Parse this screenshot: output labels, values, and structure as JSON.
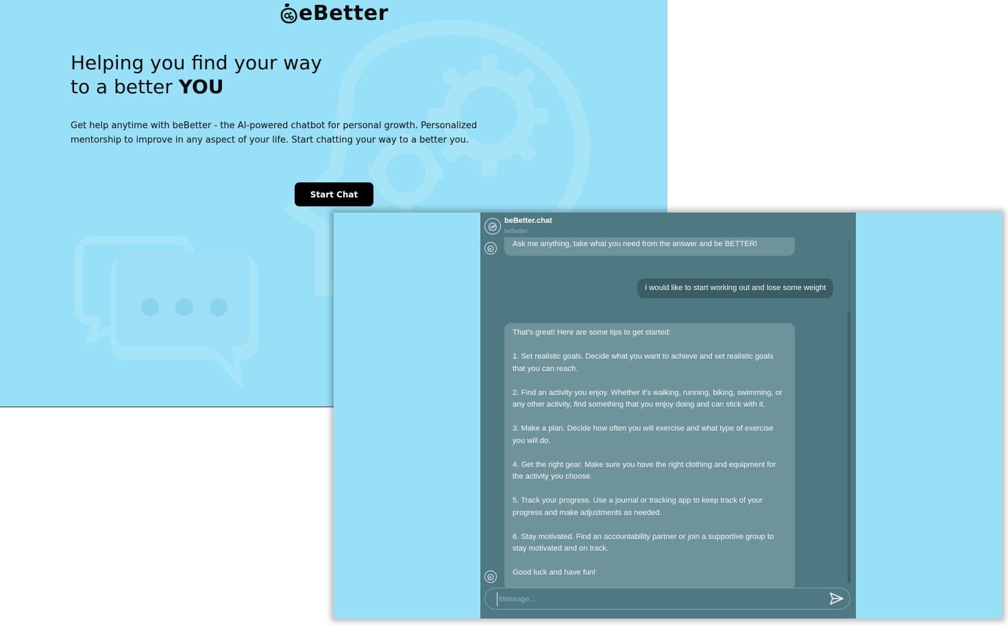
{
  "landing": {
    "brand": "eBetter",
    "hero_line1": "Helping you find your way",
    "hero_line2_prefix": "to a better ",
    "hero_line2_emphasis": "YOU",
    "description": "Get help anytime with beBetter - the AI-powered chatbot for personal growth. Personalized mentorship to improve in any aspect of your life. Start chatting your way to a better you.",
    "cta_label": "Start Chat"
  },
  "chat": {
    "title": "beBetter.chat",
    "subtitle": "beBetter",
    "messages": [
      {
        "sender": "bot",
        "text": "Ask me anything, take what you need from the answer and be BETTER!"
      },
      {
        "sender": "user",
        "text": "I would like to start working out and lose some weight"
      },
      {
        "sender": "bot",
        "paragraphs": [
          "That's great! Here are some tips to get started:",
          "1. Set realistic goals. Decide what you want to achieve and set realistic goals that you can reach.",
          "2. Find an activity you enjoy. Whether it's walking, running, biking, swimming, or any other activity, find something that you enjoy doing and can stick with it.",
          "3. Make a plan. Decide how often you will exercise and what type of exercise you will do.",
          "4. Get the right gear. Make sure you have the right clothing and equipment for the activity you choose.",
          "5. Track your progress. Use a journal or tracking app to keep track of your progress and make adjustments as needed.",
          "6. Stay motivated. Find an accountability partner or join a supportive group to stay motivated and on track.",
          "Good luck and have fun!"
        ]
      }
    ],
    "input_placeholder": "Message...",
    "input_value": ""
  },
  "icons": {
    "brand": "brain-gear-icon",
    "avatar": "brain-avatar-icon",
    "send": "send-icon"
  },
  "colors": {
    "page_background": "#97e0f7",
    "chat_panel": "#4e7882",
    "bot_bubble": "#6f939a",
    "user_bubble": "#3b5e66",
    "cta_button": "#000000"
  }
}
